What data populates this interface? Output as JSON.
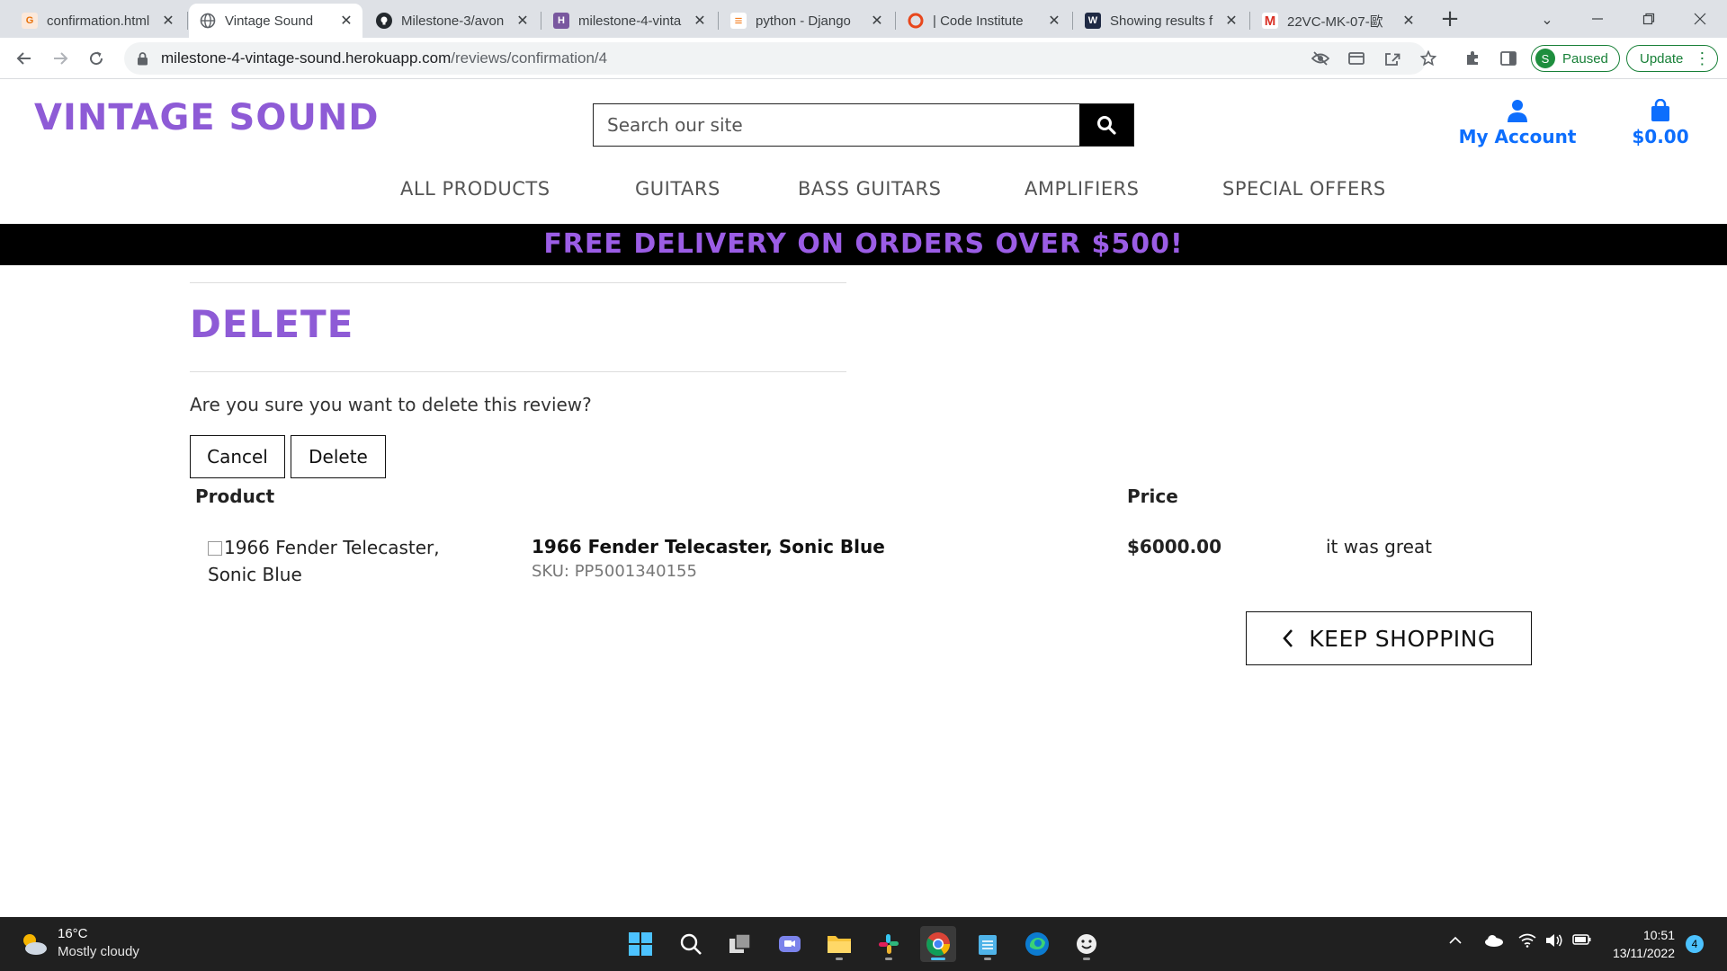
{
  "browser": {
    "tabs": [
      {
        "title": "confirmation.html",
        "favicon": "g-icon",
        "active": false
      },
      {
        "title": "Vintage Sound",
        "favicon": "globe-icon",
        "active": true
      },
      {
        "title": "Milestone-3/avon",
        "favicon": "github-icon",
        "active": false
      },
      {
        "title": "milestone-4-vinta",
        "favicon": "heroku-icon",
        "active": false
      },
      {
        "title": "python - Django",
        "favicon": "stackoverflow-icon",
        "active": false
      },
      {
        "title": "| Code Institute",
        "favicon": "codeinstitute-icon",
        "active": false
      },
      {
        "title": "Showing results f",
        "favicon": "search-results-icon",
        "active": false
      },
      {
        "title": "22VC-MK-07-歐",
        "favicon": "gmail-icon",
        "active": false
      }
    ],
    "url_domain": "milestone-4-vintage-sound.herokuapp.com",
    "url_path": "/reviews/confirmation/4",
    "profile_initial": "S",
    "profile_status": "Paused",
    "update_label": "Update"
  },
  "site": {
    "logo": "VINTAGE SOUND",
    "search_placeholder": "Search our site",
    "account_label": "My Account",
    "bag_total": "$0.00",
    "nav": [
      "ALL PRODUCTS",
      "GUITARS",
      "BASS GUITARS",
      "AMPLIFIERS",
      "SPECIAL OFFERS"
    ],
    "promo": "FREE DELIVERY ON ORDERS OVER $500!",
    "brand_color": "#8e5bd6",
    "link_color": "#0d6efd"
  },
  "page": {
    "heading": "DELETE",
    "question": "Are you sure you want to delete this review?",
    "cancel_label": "Cancel",
    "delete_label": "Delete",
    "table_headers": {
      "product": "Product",
      "price": "Price"
    },
    "item": {
      "image_alt": "1966 Fender Telecaster, Sonic Blue",
      "name": "1966 Fender Telecaster, Sonic Blue",
      "sku": "SKU: PP5001340155",
      "price": "$6000.00",
      "review": "it was great"
    },
    "keep_shopping_label": "KEEP SHOPPING"
  },
  "taskbar": {
    "temperature": "16°C",
    "weather": "Mostly cloudy",
    "time": "10:51",
    "date": "13/11/2022",
    "notifications": "4"
  }
}
